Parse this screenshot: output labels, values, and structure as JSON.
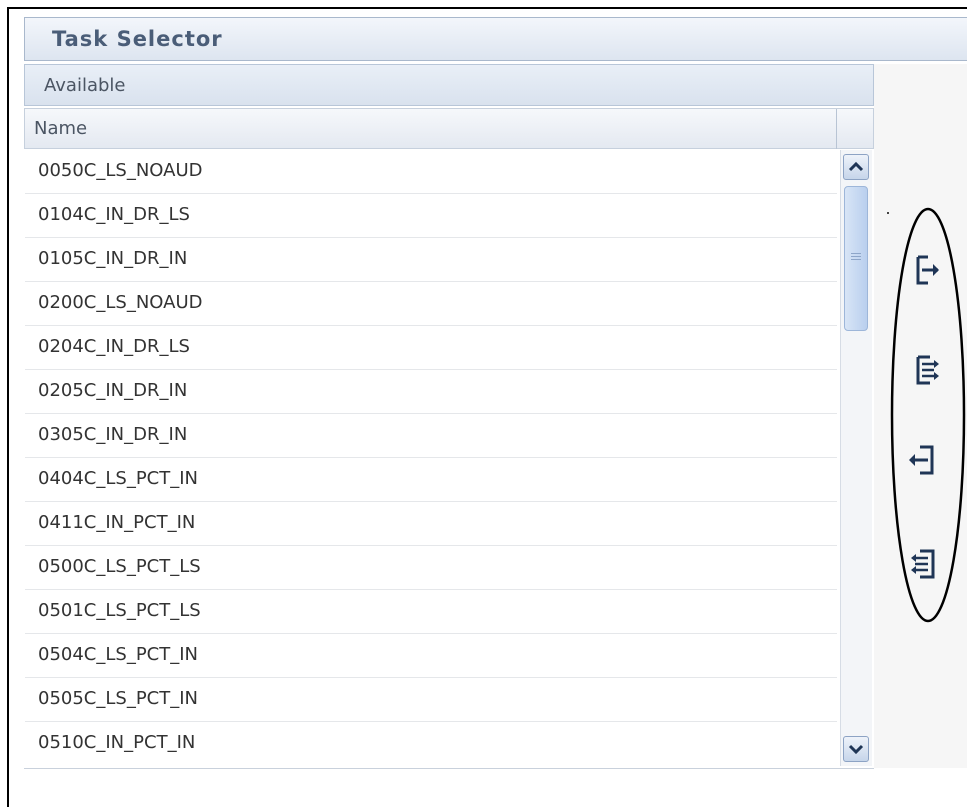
{
  "title": "Task Selector",
  "available_header": "Available",
  "column_header": "Name",
  "items": [
    "0050C_LS_NOAUD",
    "0104C_IN_DR_LS",
    "0105C_IN_DR_IN",
    "0200C_LS_NOAUD",
    "0204C_IN_DR_LS",
    "0205C_IN_DR_IN",
    "0305C_IN_DR_IN",
    "0404C_LS_PCT_IN",
    "0411C_IN_PCT_IN",
    "0500C_LS_PCT_LS",
    "0501C_LS_PCT_LS",
    "0504C_LS_PCT_IN",
    "0505C_LS_PCT_IN",
    "0510C_IN_PCT_IN"
  ],
  "transfer_buttons": [
    {
      "icon": "move-right-icon"
    },
    {
      "icon": "move-all-right-icon"
    },
    {
      "icon": "move-left-icon"
    },
    {
      "icon": "move-all-left-icon"
    }
  ],
  "colors": {
    "title_text": "#4a5d78",
    "header_bg": "#dde5f0",
    "scrollbar_thumb": "#b9cfee",
    "annotation": "#000000"
  }
}
